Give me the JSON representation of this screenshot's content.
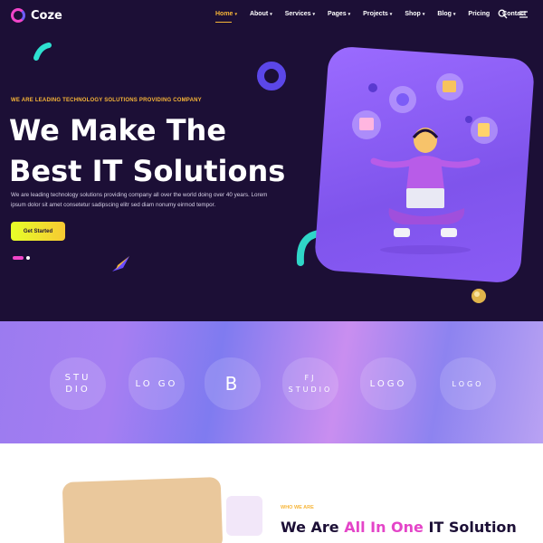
{
  "brand": {
    "name": "Coze",
    "accent": "#f145c9",
    "secondary": "#6f5cff",
    "highlight": "#f7b538"
  },
  "nav": {
    "items": [
      {
        "label": "Home",
        "active": true,
        "has_dropdown": true
      },
      {
        "label": "About",
        "has_dropdown": true
      },
      {
        "label": "Services",
        "has_dropdown": true
      },
      {
        "label": "Pages",
        "has_dropdown": true
      },
      {
        "label": "Projects",
        "has_dropdown": true
      },
      {
        "label": "Shop",
        "has_dropdown": true
      },
      {
        "label": "Blog",
        "has_dropdown": true
      },
      {
        "label": "Pricing",
        "has_dropdown": false
      },
      {
        "label": "Contact",
        "has_dropdown": false
      }
    ],
    "icons": [
      "search-icon",
      "hamburger-icon"
    ]
  },
  "hero": {
    "eyebrow": "WE ARE LEADING TECHNOLOGY SOLUTIONS PROVIDING COMPANY",
    "headline": "We Make The Best IT Solutions",
    "description": "We are leading technology solutions providing company all over the world doing over 40 years. Lorem ipsum dolor sit amet consetetur sadipscing elitr sed diam nonumy eirmod tempor.",
    "cta_label": "Get Started",
    "background": "#1c0f36"
  },
  "clients": {
    "logos": [
      {
        "text": "STU DIO"
      },
      {
        "text": "LO GO"
      },
      {
        "text": "B"
      },
      {
        "text": "FJ STUDIO"
      },
      {
        "text": "LOGO"
      },
      {
        "text": "LOGO"
      }
    ]
  },
  "about": {
    "eyebrow": "WHO WE ARE",
    "title_prefix": "We Are ",
    "title_highlight": "All In One",
    "title_suffix": " IT Solution"
  }
}
